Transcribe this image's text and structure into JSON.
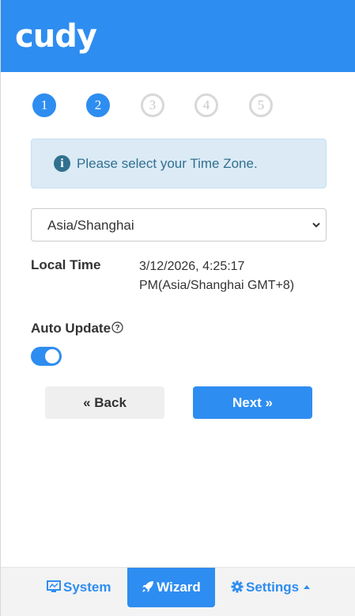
{
  "header": {
    "logo_text": "cudy",
    "brand_color": "#2e8df0"
  },
  "steps": [
    {
      "label": "1",
      "state": "done"
    },
    {
      "label": "2",
      "state": "done"
    },
    {
      "label": "3",
      "state": "todo"
    },
    {
      "label": "4",
      "state": "todo"
    },
    {
      "label": "5",
      "state": "todo"
    }
  ],
  "alert": {
    "icon": "info-icon",
    "icon_glyph": "i",
    "text": "Please select your Time Zone."
  },
  "timezone": {
    "selected": "Asia/Shanghai"
  },
  "local_time": {
    "label": "Local Time",
    "value": "3/12/2026, 4:25:17 PM(Asia/Shanghai GMT+8)"
  },
  "auto_update": {
    "label": "Auto Update",
    "help_glyph": "?",
    "enabled": true
  },
  "buttons": {
    "back": "« Back",
    "next": "Next »"
  },
  "bottom_nav": {
    "system": "System",
    "wizard": "Wizard",
    "settings": "Settings"
  }
}
